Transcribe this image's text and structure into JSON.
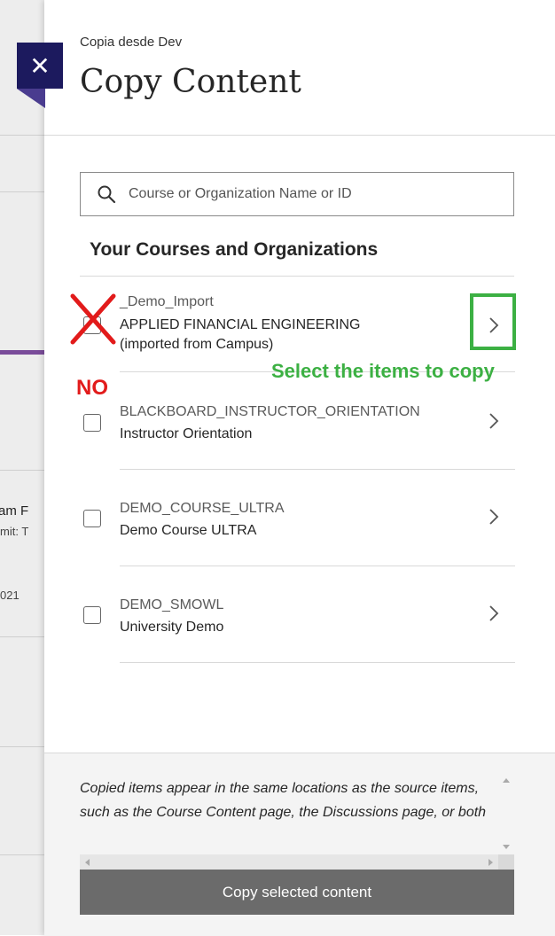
{
  "panel": {
    "breadcrumb": "Copia desde Dev",
    "title": "Copy Content"
  },
  "search": {
    "placeholder": "Course or Organization Name or ID"
  },
  "section_title": "Your Courses and Organizations",
  "courses": [
    {
      "id": "_Demo_Import",
      "name_line1": "APPLIED FINANCIAL ENGINEERING",
      "name_line2": "(imported from Campus)"
    },
    {
      "id": "BLACKBOARD_INSTRUCTOR_ORIENTATION",
      "name_line1": "Instructor Orientation"
    },
    {
      "id": "DEMO_COURSE_ULTRA",
      "name_line1": "Demo Course ULTRA"
    },
    {
      "id": "DEMO_SMOWL",
      "name_line1": "University Demo"
    }
  ],
  "annotations": {
    "select_hint": "Select the items to copy",
    "no_label": "NO"
  },
  "footer": {
    "note": "Copied items appear in the same locations as the source items, such as the Course Content page, the Discussions page, or both",
    "copy_button": "Copy selected content"
  },
  "background": {
    "text1": "am F",
    "text2": "mit: T",
    "text3": "021"
  },
  "colors": {
    "close_bg": "#1c1a5e",
    "annotation_green": "#3cb043",
    "annotation_red": "#e21b1b",
    "button_bg": "#6b6b6b"
  }
}
